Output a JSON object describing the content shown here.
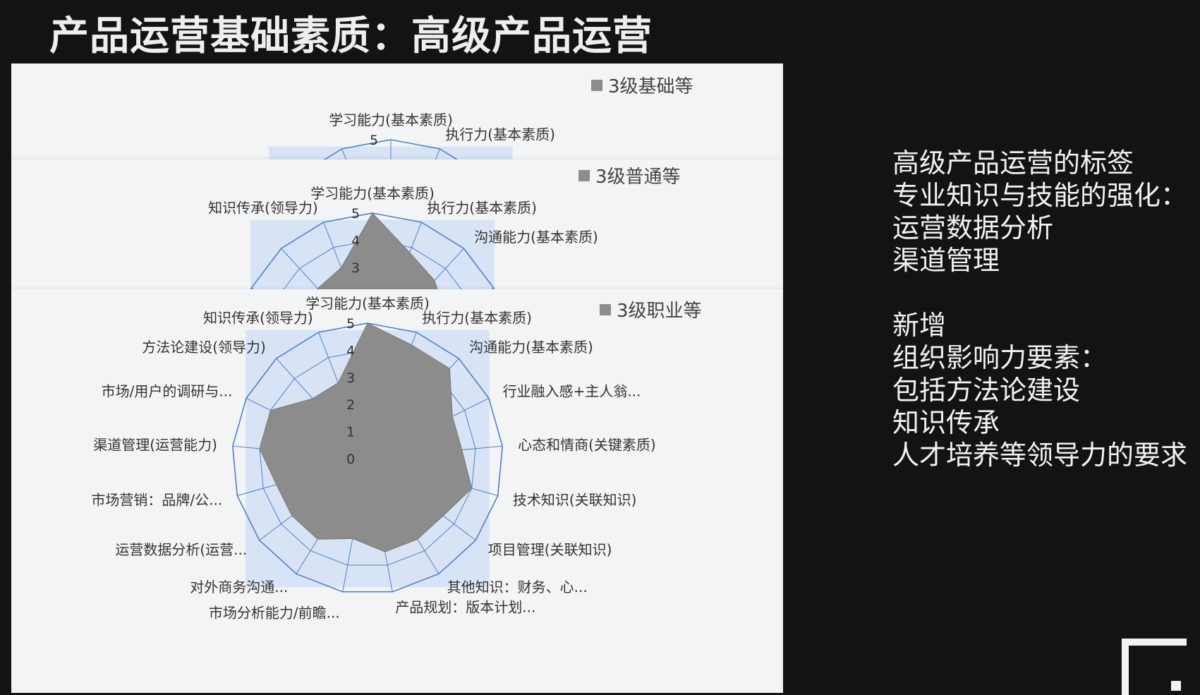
{
  "slide": {
    "title": "产品运营基础素质：高级产品运营"
  },
  "side_text": {
    "lines_top": [
      "高级产品运营的标签",
      "专业知识与技能的强化：",
      "运营数据分析",
      "渠道管理"
    ],
    "lines_bottom": [
      "新增",
      "组织影响力要素：",
      "包括方法论建设",
      "知识传承",
      "人才培养等领导力的要求"
    ]
  },
  "colors": {
    "series_fill": "#8c8c8c",
    "grid": "#4f7fc9",
    "band": "#d8e4f6",
    "panel": "#f3f4f6"
  },
  "icons": [
    "corner-logo-icon"
  ],
  "chart_data": [
    {
      "type": "radar",
      "legend": [
        "3级基础等"
      ],
      "legend_position": "top-right",
      "visible_labels": [
        "学习能力(基本素质)",
        "执行力(基本素质)"
      ],
      "axis_ticks": [
        "5"
      ]
    },
    {
      "type": "radar",
      "legend": [
        "3级普通等"
      ],
      "legend_position": "top-right",
      "visible_labels": [
        "学习能力(基本素质)",
        "执行力(基本素质)",
        "沟通能力(基本素质)",
        "知识传承(领导力)"
      ],
      "axis_ticks": [
        "5",
        "4",
        "3"
      ]
    },
    {
      "type": "radar",
      "legend": [
        "3级职业等"
      ],
      "legend_position": "top-right",
      "rlim": [
        0,
        5
      ],
      "rticks": [
        "0",
        "1",
        "2",
        "3",
        "4",
        "5"
      ],
      "categories": [
        "学习能力(基本素质)",
        "执行力(基本素质)",
        "沟通能力(基本素质)",
        "行业融入感+主人翁...",
        "心态和情商(关键素质)",
        "技术知识(关联知识)",
        "项目管理(关联知识)",
        "其他知识：财务、心...",
        "产品规划：版本计划...",
        "市场分析能力/前瞻...",
        "对外商务沟通...",
        "运营数据分析(运营...",
        "市场营销：品牌/公...",
        "渠道管理(运营能力)",
        "市场/用户的调研与...",
        "方法论建设(领导力)",
        "知识传承(领导力)"
      ],
      "series": [
        {
          "name": "3级职业等",
          "values": [
            5,
            4.5,
            4.5,
            3.5,
            3.5,
            4,
            3.5,
            3.5,
            3.5,
            3,
            3.5,
            3.5,
            3.5,
            4,
            4,
            3,
            3
          ]
        }
      ]
    }
  ]
}
